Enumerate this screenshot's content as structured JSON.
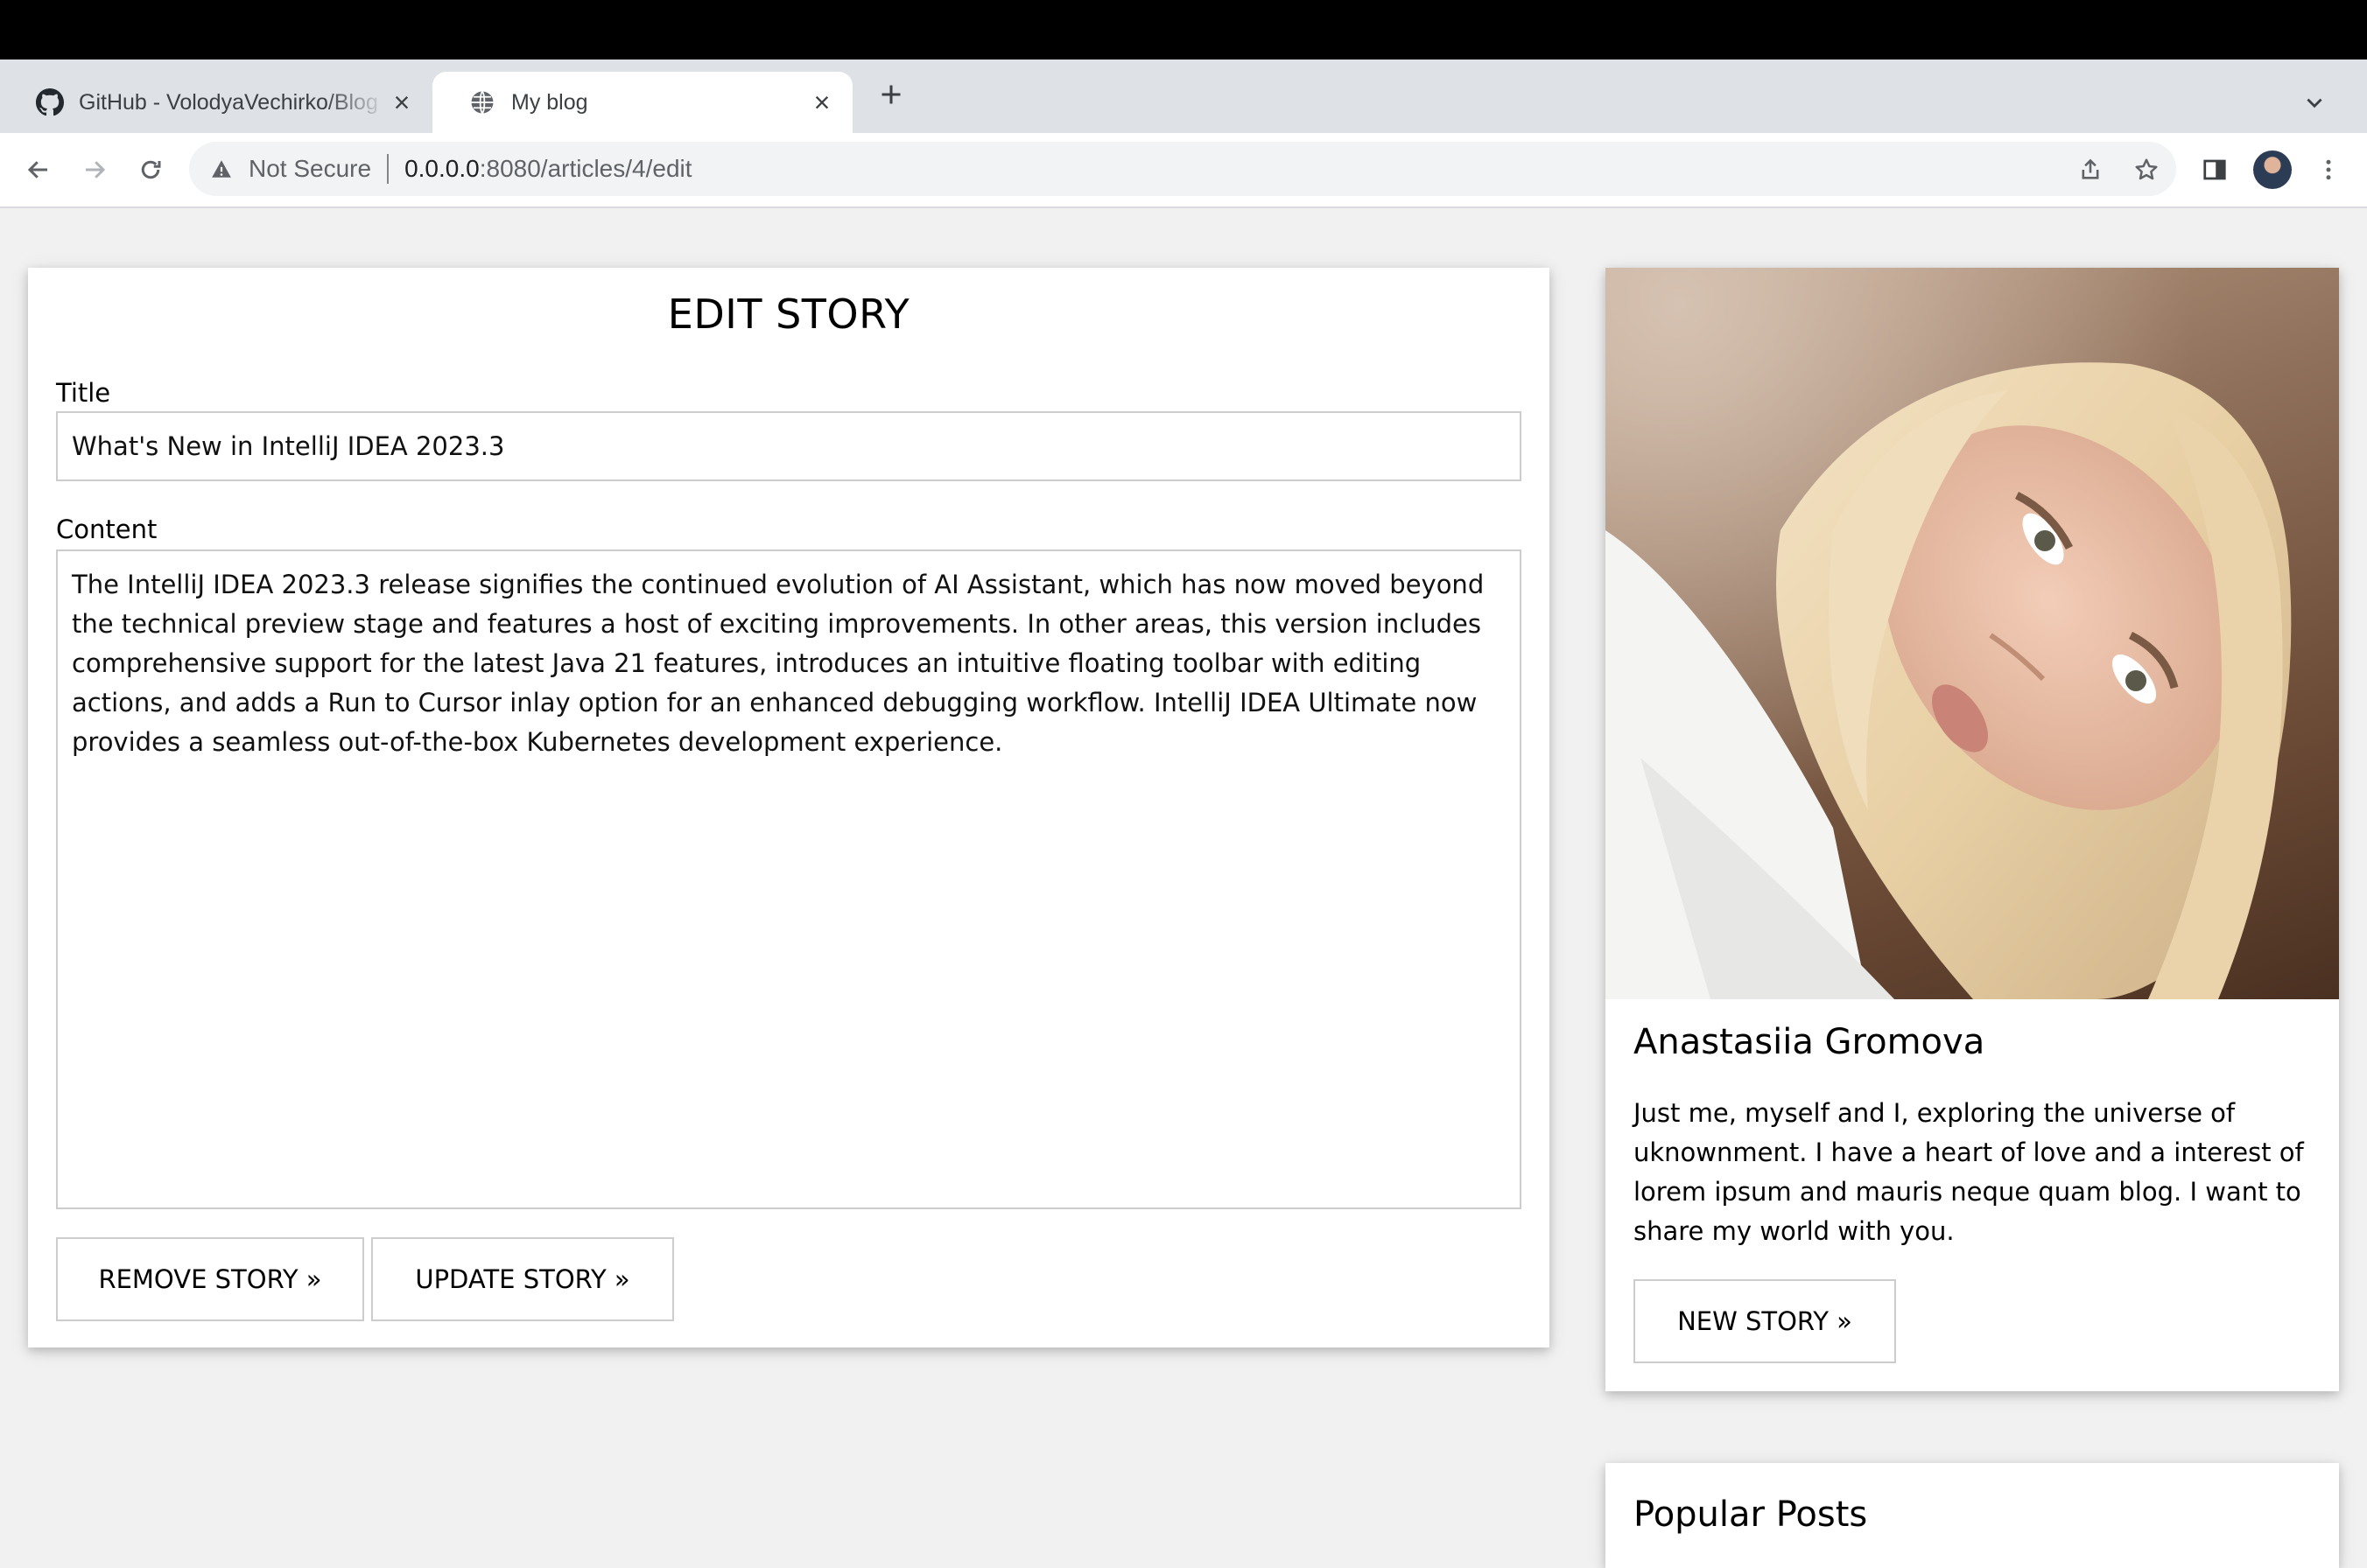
{
  "browser": {
    "tabs": [
      {
        "title": "GitHub - VolodyaVechirko/Blog",
        "icon": "github-icon",
        "active": false
      },
      {
        "title": "My blog",
        "icon": "globe-icon",
        "active": true
      }
    ],
    "security_label": "Not Secure",
    "url_host": "0.0.0.0",
    "url_path": ":8080/articles/4/edit"
  },
  "edit_form": {
    "heading": "EDIT STORY",
    "title_label": "Title",
    "title_value": "What's New in IntelliJ IDEA 2023.3",
    "content_label": "Content",
    "content_value": "The IntelliJ IDEA 2023.3 release signifies the continued evolution of AI Assistant, which has now moved beyond the technical preview stage and features a host of exciting improvements. In other areas, this version includes comprehensive support for the latest Java 21 features, introduces an intuitive floating toolbar with editing actions, and adds a Run to Cursor inlay option for an enhanced debugging workflow. IntelliJ IDEA Ultimate now provides a seamless out-of-the-box Kubernetes development experience.",
    "remove_label": "REMOVE STORY »",
    "update_label": "UPDATE STORY »"
  },
  "profile": {
    "name": "Anastasiia Gromova",
    "bio": "Just me, myself and I, exploring the universe of uknownment. I have a heart of love and a interest of lorem ipsum and mauris neque quam blog. I want to share my world with you.",
    "new_story_label": "NEW STORY »"
  },
  "popular": {
    "heading": "Popular Posts"
  }
}
